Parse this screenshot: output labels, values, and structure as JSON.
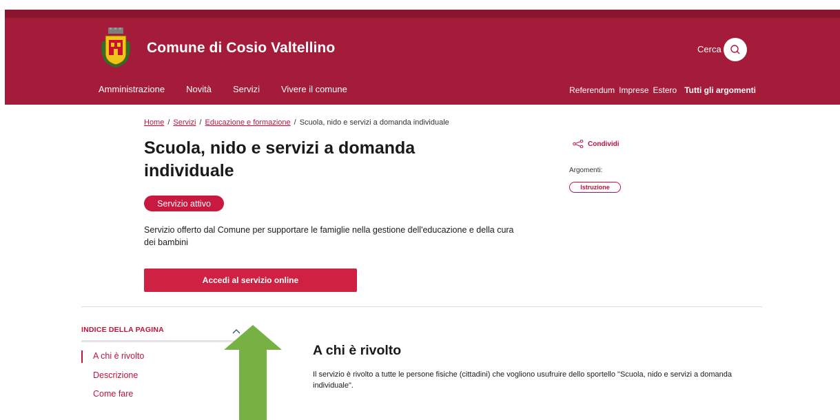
{
  "header": {
    "site_title": "Comune di Cosio Valtellino",
    "search_label": "Cerca",
    "search_icon": "search-icon",
    "nav_main": [
      "Amministrazione",
      "Novità",
      "Servizi",
      "Vivere il comune"
    ],
    "nav_right": [
      "Referendum",
      "Imprese",
      "Estero"
    ],
    "nav_right_bold": "Tutti gli argomenti",
    "brand_color": "#a51c3b"
  },
  "breadcrumb": {
    "items": [
      "Home",
      "Servizi",
      "Educazione e formazione"
    ],
    "separator": "/",
    "current": "Scuola, nido e servizi a domanda individuale"
  },
  "main": {
    "title": "Scuola, nido e servizi a domanda individuale",
    "status_badge": "Servizio attivo",
    "description": "Servizio offerto dal Comune per supportare le famiglie nella gestione dell'educazione e della cura dei bambini",
    "cta_label": "Accedi al servizio online"
  },
  "aside": {
    "share_label": "Condividi",
    "topics_label": "Argomenti:",
    "topics": [
      "Istruzione"
    ]
  },
  "toc": {
    "heading": "INDICE DELLA PAGINA",
    "items": [
      "A chi è rivolto",
      "Descrizione",
      "Come fare"
    ]
  },
  "section": {
    "title": "A chi è rivolto",
    "body": "Il servizio è rivolto a tutte le persone fisiche (cittadini) che vogliono usufruire dello sportello \"Scuola, nido e servizi a domanda individuale\"."
  },
  "colors": {
    "accent": "#c0123d",
    "annotation_arrow": "#77b043"
  }
}
